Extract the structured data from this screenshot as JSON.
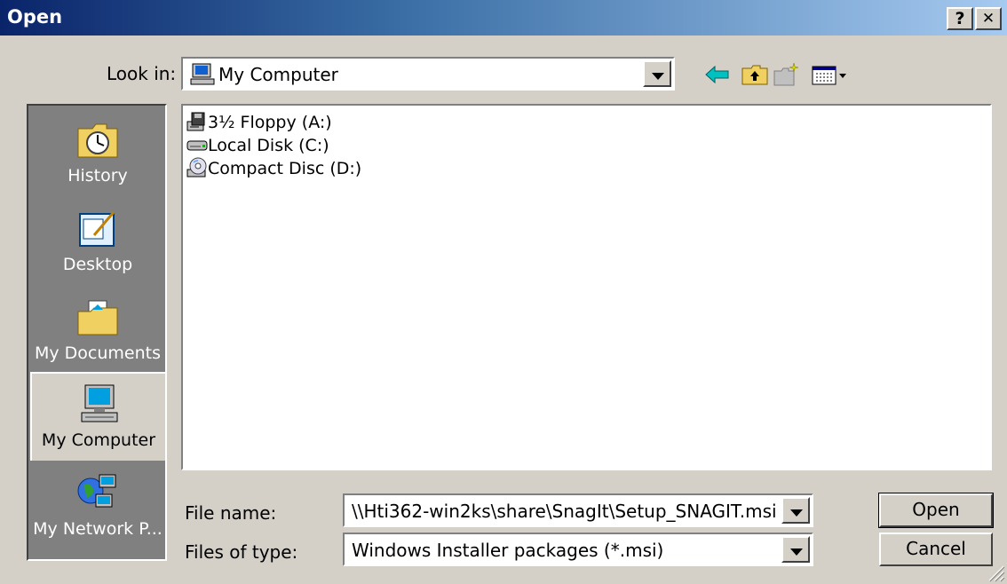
{
  "window": {
    "title": "Open",
    "help_label": "?",
    "close_label": "✕"
  },
  "look_in": {
    "label": "Look in:",
    "value": "My Computer"
  },
  "toolbar": {
    "icons": [
      "back-arrow-icon",
      "up-folder-icon",
      "new-folder-icon",
      "view-menu-icon"
    ]
  },
  "places": [
    {
      "label": "History",
      "icon": "history-icon",
      "selected": false
    },
    {
      "label": "Desktop",
      "icon": "desktop-icon",
      "selected": false
    },
    {
      "label": "My Documents",
      "icon": "my-documents-icon",
      "selected": false
    },
    {
      "label": "My Computer",
      "icon": "my-computer-icon",
      "selected": true
    },
    {
      "label": "My Network P...",
      "icon": "network-places-icon",
      "selected": false
    }
  ],
  "files": [
    {
      "label": "3½ Floppy (A:)",
      "icon": "floppy-drive-icon"
    },
    {
      "label": "Local Disk (C:)",
      "icon": "hard-disk-icon"
    },
    {
      "label": "Compact Disc (D:)",
      "icon": "cd-drive-icon"
    }
  ],
  "file_name": {
    "label": "File name:",
    "value": "\\\\Hti362-win2ks\\share\\SnagIt\\Setup_SNAGIT.msi"
  },
  "file_type": {
    "label": "Files of type:",
    "value": "Windows Installer packages (*.msi)"
  },
  "buttons": {
    "open": "Open",
    "cancel": "Cancel"
  }
}
